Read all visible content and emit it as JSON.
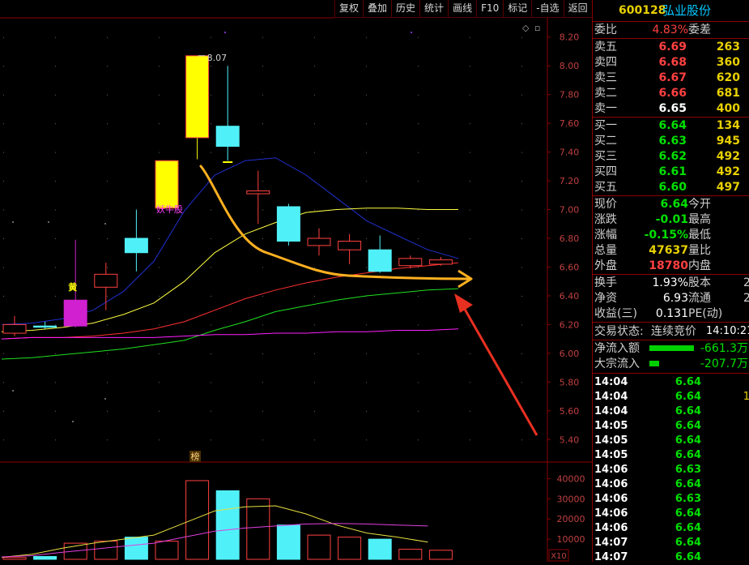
{
  "toolbar": {
    "items": [
      "复权",
      "叠加",
      "历史",
      "统计",
      "画线",
      "F10",
      "标记",
      "-自选",
      "返回"
    ]
  },
  "stock": {
    "code": "600128",
    "name": "弘业股份"
  },
  "orderbook": {
    "weibi_label": "委比",
    "weibi_value": "4.83%",
    "weicha_label": "委差",
    "asks": [
      {
        "label": "卖五",
        "price": "6.69",
        "vol": "263"
      },
      {
        "label": "卖四",
        "price": "6.68",
        "vol": "360"
      },
      {
        "label": "卖三",
        "price": "6.67",
        "vol": "620"
      },
      {
        "label": "卖二",
        "price": "6.66",
        "vol": "681"
      },
      {
        "label": "卖一",
        "price": "6.65",
        "vol": "400"
      }
    ],
    "bids": [
      {
        "label": "买一",
        "price": "6.64",
        "vol": "134"
      },
      {
        "label": "买二",
        "price": "6.63",
        "vol": "945"
      },
      {
        "label": "买三",
        "price": "6.62",
        "vol": "492"
      },
      {
        "label": "买四",
        "price": "6.61",
        "vol": "492"
      },
      {
        "label": "买五",
        "price": "6.60",
        "vol": "497"
      }
    ]
  },
  "quote": [
    {
      "label": "现价",
      "value": "6.64",
      "label2": "今开",
      "color": "green"
    },
    {
      "label": "涨跌",
      "value": "-0.01",
      "label2": "最高",
      "color": "green"
    },
    {
      "label": "涨幅",
      "value": "-0.15%",
      "label2": "最低",
      "color": "green"
    },
    {
      "label": "总量",
      "value": "47637",
      "label2": "量比",
      "color": "yellow"
    },
    {
      "label": "外盘",
      "value": "18780",
      "label2": "内盘",
      "color": "red"
    }
  ],
  "fundamentals": [
    {
      "label": "换手",
      "value": "1.93%",
      "label2": "股本",
      "extra": "2"
    },
    {
      "label": "净资",
      "value": "6.93",
      "label2": "流通",
      "extra": "2"
    },
    {
      "label": "收益(三)",
      "value": "0.131",
      "label2": "PE(动)",
      "extra": ""
    }
  ],
  "trading": {
    "status_label": "交易状态:",
    "status_value": "连续竞价",
    "time": "14:10:21"
  },
  "flows": [
    {
      "label": "净流入额",
      "value": "-661.3万",
      "bar": 0.55
    },
    {
      "label": "大宗流入",
      "value": "-207.7万",
      "bar": 0.12
    }
  ],
  "ticks": [
    {
      "time": "14:04",
      "price": "6.64",
      "extra": ""
    },
    {
      "time": "14:04",
      "price": "6.64",
      "extra": "1"
    },
    {
      "time": "14:04",
      "price": "6.64",
      "extra": ""
    },
    {
      "time": "14:05",
      "price": "6.64",
      "extra": ""
    },
    {
      "time": "14:05",
      "price": "6.64",
      "extra": ""
    },
    {
      "time": "14:05",
      "price": "6.64",
      "extra": ""
    },
    {
      "time": "14:06",
      "price": "6.63",
      "extra": ""
    },
    {
      "time": "14:06",
      "price": "6.64",
      "extra": ""
    },
    {
      "time": "14:06",
      "price": "6.63",
      "extra": ""
    },
    {
      "time": "14:06",
      "price": "6.64",
      "extra": ""
    },
    {
      "time": "14:06",
      "price": "6.64",
      "extra": ""
    },
    {
      "time": "14:07",
      "price": "6.64",
      "extra": ""
    },
    {
      "time": "14:07",
      "price": "6.64",
      "extra": ""
    }
  ],
  "annotations": {
    "high_label": "8.07",
    "yaogu_label": "妖牛股",
    "huang_label": "黄",
    "bang_label": "榜",
    "vol_multiplier": "X10"
  },
  "chart_data": [
    {
      "type": "candlestick",
      "ylim": [
        5.3,
        8.3
      ],
      "yticks": [
        "8.20",
        "8.00",
        "7.80",
        "7.60",
        "7.40",
        "7.20",
        "7.00",
        "6.80",
        "6.60",
        "6.40",
        "6.20",
        "6.00",
        "5.80",
        "5.60",
        "5.40"
      ],
      "candles": [
        {
          "o": 6.14,
          "c": 6.2,
          "h": 6.26,
          "l": 6.12,
          "color": "red"
        },
        {
          "o": 6.19,
          "c": 6.19,
          "h": 6.22,
          "l": 6.17,
          "color": "cyan"
        },
        {
          "o": 6.19,
          "c": 6.37,
          "h": 6.79,
          "l": 6.18,
          "color": "magenta"
        },
        {
          "o": 6.46,
          "c": 6.55,
          "h": 6.63,
          "l": 6.3,
          "color": "red"
        },
        {
          "o": 6.7,
          "c": 6.8,
          "h": 7.0,
          "l": 6.57,
          "color": "cyan"
        },
        {
          "o": 7.01,
          "c": 7.34,
          "h": 7.34,
          "l": 7.01,
          "color": "yellow"
        },
        {
          "o": 7.5,
          "c": 8.07,
          "h": 8.07,
          "l": 7.35,
          "color": "yellow"
        },
        {
          "o": 7.58,
          "c": 7.44,
          "h": 8.0,
          "l": 7.34,
          "color": "cyan"
        },
        {
          "o": 7.11,
          "c": 7.13,
          "h": 7.27,
          "l": 6.9,
          "color": "red"
        },
        {
          "o": 7.02,
          "c": 6.78,
          "h": 7.04,
          "l": 6.75,
          "color": "cyan"
        },
        {
          "o": 6.75,
          "c": 6.8,
          "h": 6.87,
          "l": 6.68,
          "color": "red"
        },
        {
          "o": 6.72,
          "c": 6.78,
          "h": 6.83,
          "l": 6.62,
          "color": "red"
        },
        {
          "o": 6.72,
          "c": 6.57,
          "h": 6.82,
          "l": 6.56,
          "color": "cyan"
        },
        {
          "o": 6.61,
          "c": 6.66,
          "h": 6.68,
          "l": 6.59,
          "color": "red"
        },
        {
          "o": 6.62,
          "c": 6.65,
          "h": 6.67,
          "l": 6.61,
          "color": "red"
        }
      ],
      "ma": [
        {
          "color": "#ffffff",
          "values": [
            6.2,
            6.21,
            6.24,
            6.3,
            6.43,
            6.64,
            6.99,
            7.24,
            7.34,
            7.36,
            7.24,
            7.08,
            6.92,
            6.82,
            6.72,
            6.66
          ]
        },
        {
          "color": "#ffff40",
          "values": [
            6.15,
            6.16,
            6.18,
            6.21,
            6.27,
            6.35,
            6.5,
            6.7,
            6.83,
            6.91,
            6.98,
            7.0,
            7.01,
            7.01,
            7.0,
            7.0
          ]
        },
        {
          "color": "#ff3030",
          "values": [
            6.1,
            6.11,
            6.11,
            6.12,
            6.14,
            6.17,
            6.22,
            6.3,
            6.38,
            6.44,
            6.49,
            6.53,
            6.56,
            6.59,
            6.61,
            6.63
          ]
        },
        {
          "color": "#20e020",
          "values": [
            5.96,
            5.97,
            5.99,
            6.01,
            6.03,
            6.06,
            6.09,
            6.16,
            6.22,
            6.29,
            6.33,
            6.37,
            6.4,
            6.42,
            6.44,
            6.45
          ]
        },
        {
          "color": "#ff20ff",
          "values": [
            6.1,
            6.11,
            6.11,
            6.11,
            6.11,
            6.11,
            6.12,
            6.13,
            6.13,
            6.14,
            6.14,
            6.15,
            6.15,
            6.16,
            6.16,
            6.17
          ]
        }
      ]
    },
    {
      "type": "bar",
      "ylim": [
        0,
        45000
      ],
      "yticks": [
        "40000",
        "30000",
        "20000",
        "10000"
      ],
      "values": [
        900,
        1400,
        8000,
        9000,
        11000,
        9000,
        39000,
        34000,
        30000,
        17000,
        12000,
        11000,
        10000,
        5000,
        4500
      ],
      "colors": [
        "red",
        "cyan",
        "red",
        "red",
        "cyan",
        "red",
        "red",
        "cyan",
        "red",
        "cyan",
        "red",
        "red",
        "cyan",
        "red",
        "red"
      ],
      "ma": [
        {
          "color": "#e8e040",
          "values": [
            1000,
            2500,
            5500,
            8000,
            10000,
            12000,
            18000,
            24000,
            26000,
            26500,
            22500,
            17000,
            13000,
            11000,
            8500
          ]
        },
        {
          "color": "#e040e0",
          "values": [
            1200,
            1800,
            3500,
            5000,
            6500,
            8000,
            11000,
            14000,
            15500,
            16500,
            17500,
            17800,
            17500,
            17000,
            16500
          ]
        }
      ]
    }
  ],
  "colors": {
    "up": "#ff4040",
    "down": "#50f0f8",
    "accent_red": "#8b0000",
    "arrow": "#e83020",
    "trend": "#ffb020"
  }
}
